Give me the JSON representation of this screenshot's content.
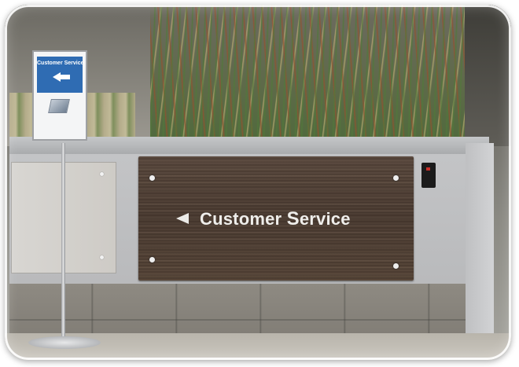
{
  "scene": {
    "counter_sign": {
      "text_prefix": "Customer ",
      "text_highlight": "S",
      "text_suffix": "ervice",
      "arrow_direction": "left"
    },
    "standing_sign": {
      "label": "Customer Service",
      "arrow_direction": "left",
      "header_color": "#2f6cb3"
    },
    "colors": {
      "counter": "#c3c4c6",
      "sign_panel": "#4c3d33",
      "tile_base": "#8e8a82",
      "card_reader_led": "#c8302a"
    }
  }
}
